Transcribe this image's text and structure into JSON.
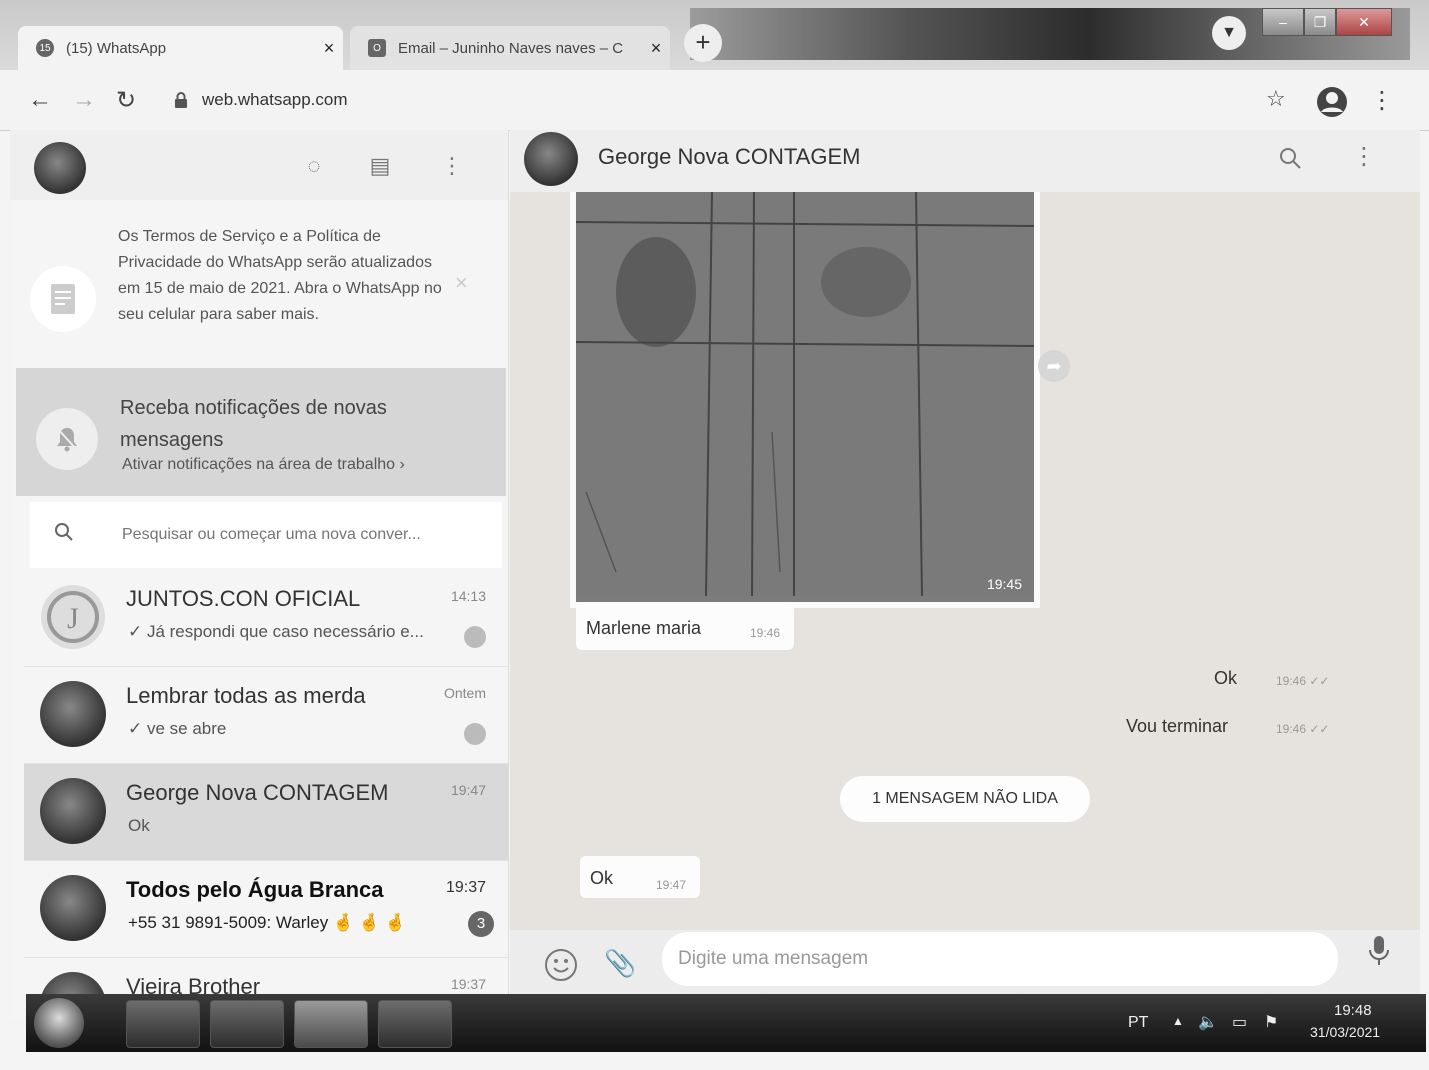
{
  "browser": {
    "tabs": [
      {
        "title": "(15) WhatsApp",
        "favicon": "15",
        "close": "×"
      },
      {
        "title": "Email – Juninho Naves naves – C",
        "favicon": "O",
        "close": "×"
      }
    ],
    "new_tab": "+",
    "url": "web.whatsapp.com"
  },
  "sidebar": {
    "tos_notice": "Os Termos de Serviço e a Política de Privacidade do WhatsApp serão atualizados em 15 de maio de 2021. Abra o WhatsApp no seu celular para saber mais.",
    "tos_close": "×",
    "notif_title": "Receba notificações de novas mensagens",
    "notif_link": "Ativar notificações na área de trabalho ›",
    "search_placeholder": "Pesquisar ou começar uma nova conver...",
    "chats": [
      {
        "name": "JUNTOS.CON OFICIAL",
        "preview": "✓ Já respondi que caso necessário e...",
        "time": "14:13"
      },
      {
        "name": "Lembrar todas as merda",
        "preview": "✓ ve se abre",
        "time": "Ontem"
      },
      {
        "name": "George Nova CONTAGEM",
        "preview": "Ok",
        "time": "19:47"
      },
      {
        "name": "Todos pelo Água Branca",
        "preview": "+55 31 9891-5009: Warley 🤞 🤞 🤞",
        "time": "19:37",
        "badge": "3"
      },
      {
        "name": "Vieira Brother",
        "preview": "",
        "time": "19:37"
      }
    ]
  },
  "conversation": {
    "contact_name": "George Nova CONTAGEM",
    "photo_time": "19:45",
    "messages": [
      {
        "text": "Marlene maria",
        "time": "19:46",
        "direction": "in"
      },
      {
        "text": "Ok",
        "time": "19:46 ✓✓",
        "direction": "out"
      },
      {
        "text": "Vou terminar",
        "time": "19:46 ✓✓",
        "direction": "out"
      },
      {
        "text": "Ok",
        "time": "19:47",
        "direction": "in"
      }
    ],
    "unread_divider": "1 MENSAGEM NÃO LIDA",
    "composer_placeholder": "Digite uma mensagem"
  },
  "taskbar": {
    "lang": "PT",
    "time": "19:48",
    "date": "31/03/2021"
  }
}
